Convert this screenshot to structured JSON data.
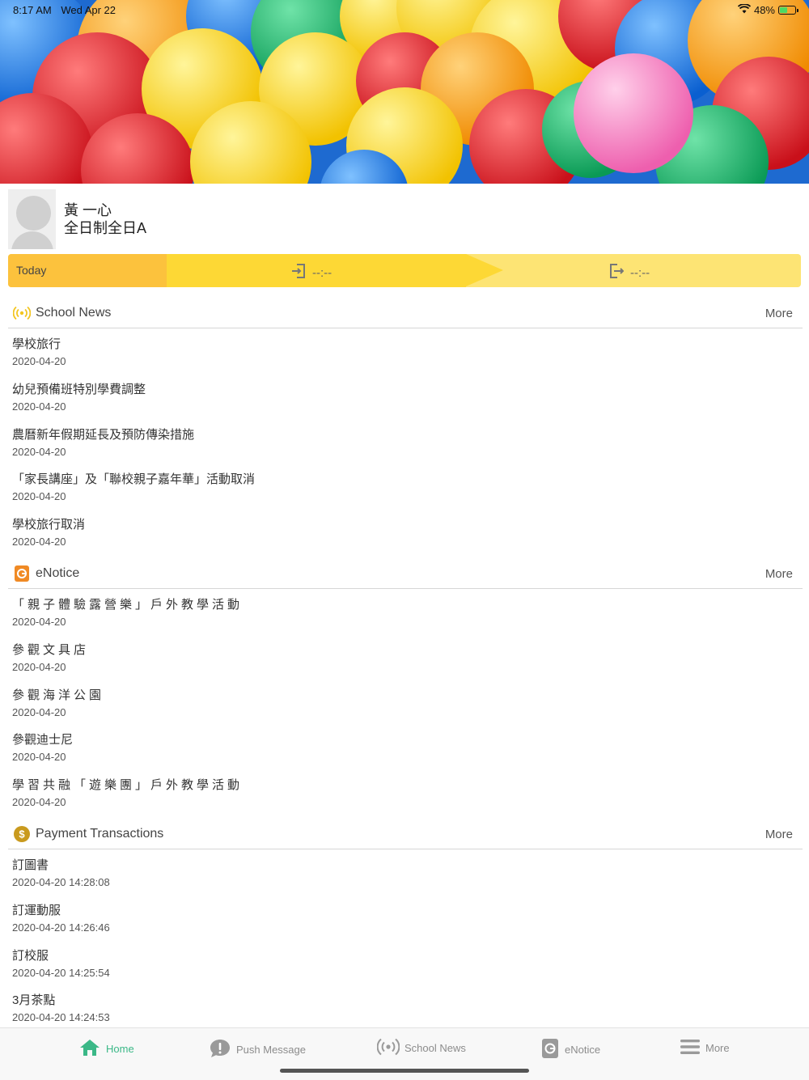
{
  "status": {
    "time": "8:17 AM",
    "date": "Wed Apr 22",
    "battery": "48%"
  },
  "profile": {
    "name": "黃 一心",
    "class": "全日制全日A"
  },
  "today": {
    "label": "Today",
    "in_time": "--:--",
    "out_time": "--:--"
  },
  "school_news": {
    "title": "School News",
    "more": "More",
    "items": [
      {
        "title": "學校旅行",
        "date": "2020-04-20"
      },
      {
        "title": "幼兒預備班特別學費調整",
        "date": "2020-04-20"
      },
      {
        "title": "農曆新年假期延長及預防傳染措施",
        "date": "2020-04-20"
      },
      {
        "title": "「家長講座」及「聯校親子嘉年華」活動取消",
        "date": "2020-04-20"
      },
      {
        "title": "學校旅行取消",
        "date": "2020-04-20"
      }
    ]
  },
  "enotice": {
    "title": "eNotice",
    "more": "More",
    "items": [
      {
        "title": "「親子體驗露營樂」戶外教學活動",
        "date": "2020-04-20"
      },
      {
        "title": "參觀文具店",
        "date": "2020-04-20"
      },
      {
        "title": "參觀海洋公園",
        "date": "2020-04-20"
      },
      {
        "title": "參觀迪士尼",
        "date": "2020-04-20"
      },
      {
        "title": "學習共融「遊樂團」戶外教學活動",
        "date": "2020-04-20"
      }
    ]
  },
  "payments": {
    "title": "Payment Transactions",
    "more": "More",
    "items": [
      {
        "title": "訂圖書",
        "date": "2020-04-20 14:28:08"
      },
      {
        "title": "訂運動服",
        "date": "2020-04-20 14:26:46"
      },
      {
        "title": "訂校服",
        "date": "2020-04-20 14:25:54"
      },
      {
        "title": "3月茶點",
        "date": "2020-04-20 14:24:53"
      }
    ]
  },
  "tabs": [
    {
      "label": "Home",
      "icon": "home-icon"
    },
    {
      "label": "Push Message",
      "icon": "message-icon"
    },
    {
      "label": "School News",
      "icon": "broadcast-icon"
    },
    {
      "label": "eNotice",
      "icon": "notice-icon"
    },
    {
      "label": "More",
      "icon": "menu-icon"
    }
  ],
  "colors": {
    "accent": "#3bb887",
    "today_label": "#fcc23d",
    "today_mid": "#fdd835",
    "today_end": "#fde474"
  }
}
